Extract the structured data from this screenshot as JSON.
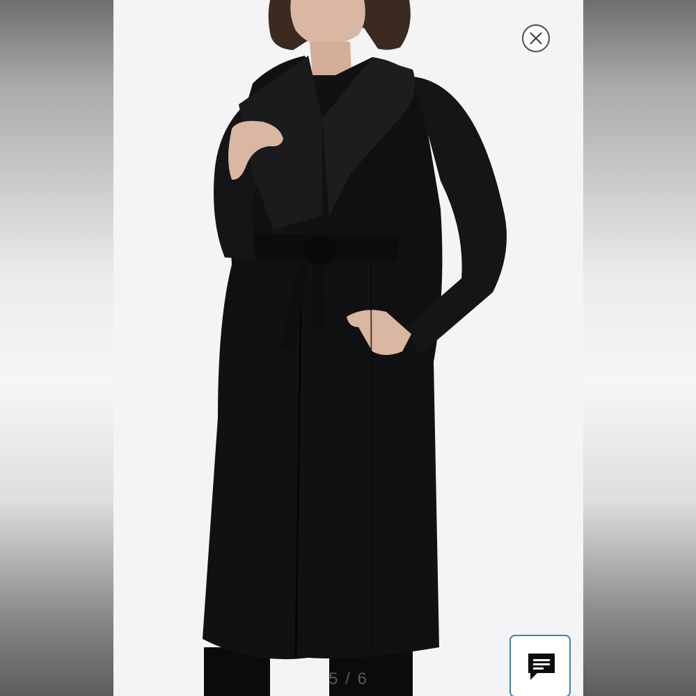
{
  "viewer": {
    "counter": "5 / 6",
    "close_icon": "close-circle-icon",
    "chat_icon": "chat-bubble-icon"
  },
  "colors": {
    "coat": "#0f0f10",
    "background": "#f4f4f6",
    "chat_border": "#3f7fa0"
  }
}
